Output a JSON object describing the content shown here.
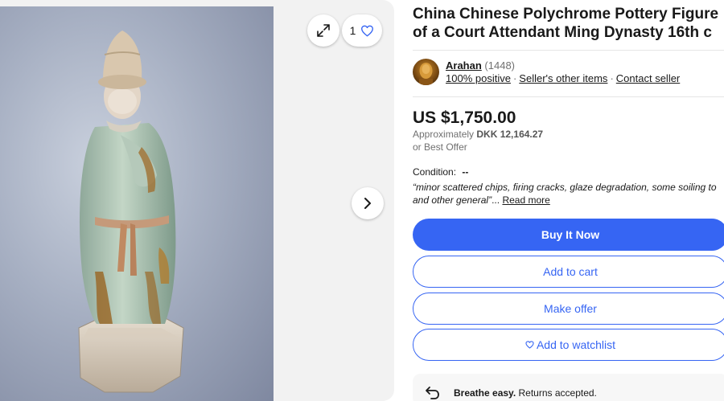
{
  "gallery": {
    "image_count": "1",
    "icons": {
      "expand": "expand-icon",
      "heart": "heart-icon",
      "next": "chevron-right-icon"
    }
  },
  "listing": {
    "title": "China Chinese Polychrome Pottery Figure of a Court Attendant Ming Dynasty 16th c"
  },
  "seller": {
    "name": "Arahan",
    "feedback_count": "(1448)",
    "positive": "100% positive",
    "other_items": "Seller's other items",
    "contact": "Contact seller"
  },
  "price": {
    "main": "US $1,750.00",
    "approx_label": "Approximately",
    "approx_value": "DKK 12,164.27",
    "best_offer": "or Best Offer"
  },
  "condition": {
    "label": "Condition:",
    "value": "--",
    "quote": "“minor scattered chips, firing cracks, glaze degradation, some soiling to and other general”",
    "ellipsis": "...",
    "read_more": "Read more"
  },
  "actions": {
    "buy_now": "Buy It Now",
    "add_to_cart": "Add to cart",
    "make_offer": "Make offer",
    "add_to_watchlist": "Add to watchlist"
  },
  "returns": {
    "bold": "Breathe easy.",
    "text": "Returns accepted."
  },
  "colors": {
    "primary": "#3665f3",
    "text": "#191919",
    "muted": "#707070"
  }
}
